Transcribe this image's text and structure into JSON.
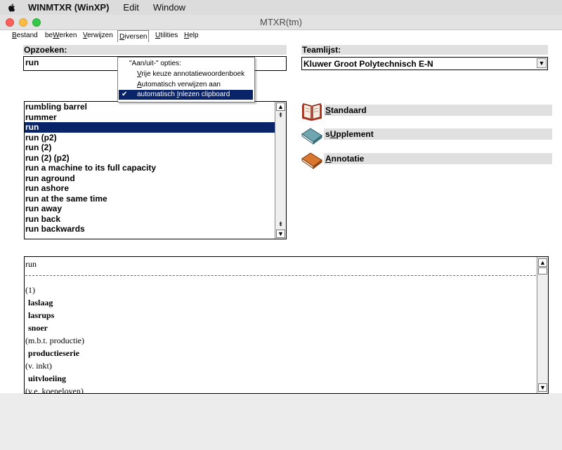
{
  "mac_menubar": {
    "app_name": "WINMTXR (WinXP)",
    "items": [
      "Edit",
      "Window"
    ]
  },
  "window": {
    "title": "MTXR(tm)"
  },
  "app_menu": [
    {
      "label": "Bestand",
      "hotkey": "B",
      "rest": "estand"
    },
    {
      "label": "beWerken",
      "pre": "be",
      "hotkey": "W",
      "rest": "erken"
    },
    {
      "label": "Verwijzen",
      "hotkey": "V",
      "rest": "erwijzen"
    },
    {
      "label": "Diversen",
      "hotkey": "D",
      "rest": "iversen"
    },
    {
      "label": "Utilities",
      "hotkey": "U",
      "rest": "tilities"
    },
    {
      "label": "Help",
      "hotkey": "H",
      "rest": "elp"
    }
  ],
  "diversen_menu": {
    "header": "\"Aan/uit-\" opties:",
    "items": [
      {
        "pre": "",
        "hotkey": "V",
        "rest": "rije keuze annotatiewoordenboek",
        "checked": false
      },
      {
        "pre": "",
        "hotkey": "A",
        "rest": "utomatisch verwijzen aan",
        "checked": false
      },
      {
        "pre": "automatisch ",
        "hotkey": "I",
        "rest": "nlezen clipboard",
        "checked": true
      }
    ],
    "check_glyph": "✔"
  },
  "opzoeken": {
    "label": "Opzoeken:",
    "value": "run"
  },
  "teamlijst": {
    "label": "Teamlijst:",
    "value": "Kluwer Groot Polytechnisch E-N"
  },
  "word_list": {
    "selected_index": 2,
    "items": [
      "rumbling barrel",
      "rummer",
      "run",
      "run  (p2)",
      "run (2)",
      "run (2)  (p2)",
      "run a machine to its full capacity",
      "run aground",
      "run ashore",
      "run at the same time",
      "run away",
      "run back",
      "run backwards"
    ]
  },
  "dictionaries": [
    {
      "pre": "",
      "hotkey": "S",
      "rest": "tandaard",
      "icon": "open-book-icon"
    },
    {
      "pre": "s",
      "hotkey": "U",
      "rest": "pplement",
      "icon": "closed-book-teal-icon"
    },
    {
      "pre": "",
      "hotkey": "A",
      "rest": "nnotatie",
      "icon": "closed-book-orange-icon"
    }
  ],
  "detail": {
    "headword": "run",
    "entries": [
      {
        "text": "(1)",
        "bold": false
      },
      {
        "text": "laslaag",
        "bold": true
      },
      {
        "text": "lasrups",
        "bold": true
      },
      {
        "text": "snoer",
        "bold": true
      },
      {
        "text": "(m.b.t. productie)",
        "bold": false
      },
      {
        "text": "productieserie",
        "bold": true
      },
      {
        "text": "(v. inkt)",
        "bold": false
      },
      {
        "text": "uitvloeiing",
        "bold": true
      },
      {
        "text": "(v.e. koepeloven)",
        "bold": false
      }
    ]
  },
  "colors": {
    "selection": "#0a246a",
    "label_bar": "#e0e0e0"
  }
}
